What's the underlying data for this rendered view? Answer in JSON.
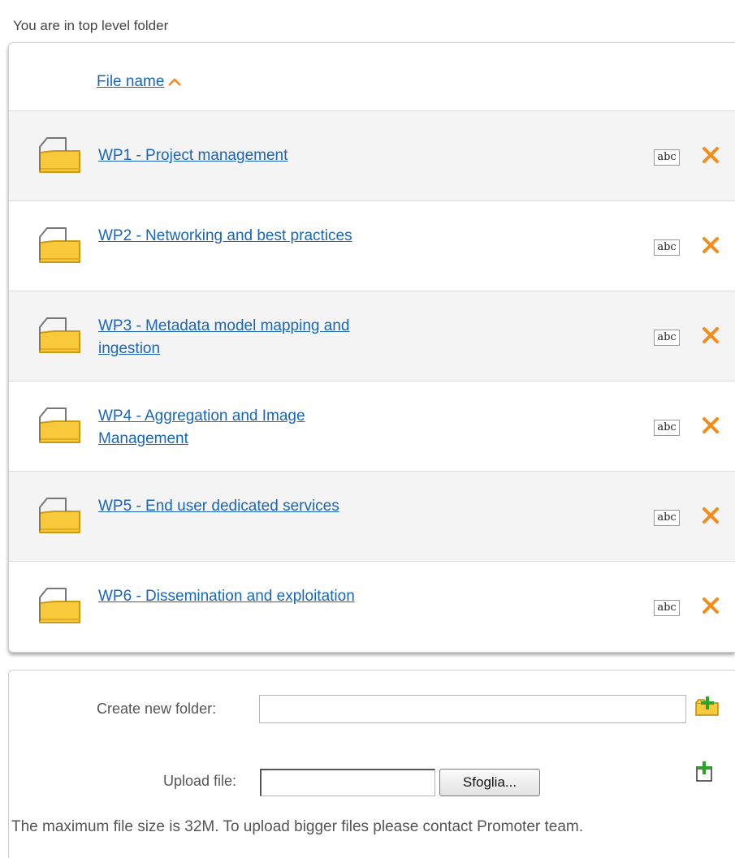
{
  "location_text": "You are in top level folder",
  "file_list": {
    "sort_label": "File name",
    "sort_direction": "ascending",
    "rename_icon_text": "abc",
    "folders": [
      {
        "name": "WP1 - Project management"
      },
      {
        "name": "WP2 - Networking and best practices"
      },
      {
        "name": "WP3 - Metadata model mapping and ingestion"
      },
      {
        "name": "WP4 - Aggregation and Image Management"
      },
      {
        "name": "WP5 - End user dedicated services"
      },
      {
        "name": "WP6 - Dissemination and exploitation"
      }
    ]
  },
  "form": {
    "create_folder_label": "Create new folder:",
    "create_folder_value": "",
    "upload_label": "Upload file:",
    "upload_value": "",
    "browse_label": "Sfoglia...",
    "max_size_note": "The maximum file size is 32M. To upload bigger files please contact Promoter team."
  },
  "colors": {
    "link": "#1a66b8",
    "folder_fill": "#f9c93c",
    "delete_x": "#f28c1b",
    "add_plus": "#2aa52a"
  }
}
